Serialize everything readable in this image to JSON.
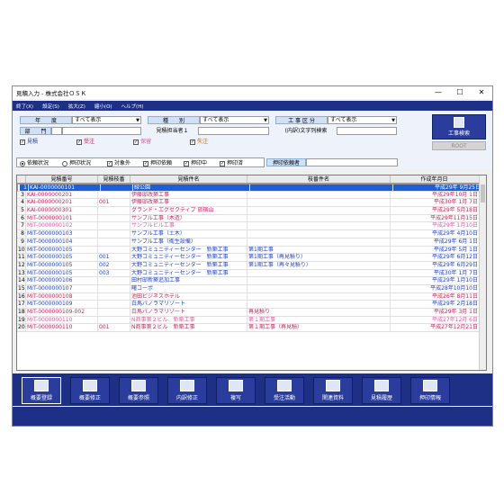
{
  "window": {
    "title": "見積入力 - 株式会社ＯＳＫ",
    "min": "—",
    "max": "☐",
    "close": "✕"
  },
  "menu": [
    "終了(X)",
    "設定(S)",
    "拡大(Z)",
    "縮小(O)",
    "ヘルプ(H)"
  ],
  "filters": {
    "year_label": "年　　度",
    "year_value": "すべて表示",
    "type_label": "種　　別",
    "type_value": "すべて表示",
    "section_label": "工 事 区 分",
    "section_value": "すべて表示",
    "dept_label": "部　　門",
    "dept_value": "",
    "estimator_label": "見積担当者１",
    "inner_label": "(内訳)文字列検索",
    "checks": [
      "見積",
      "受注",
      "保留",
      "失注"
    ],
    "radio1": "依頼状況",
    "radio2": "押印状況",
    "status_checks": [
      "対象外",
      "押印依頼",
      "押印中",
      "押印済"
    ],
    "requester_label": "押印依頼者",
    "search_button": "工事検索",
    "gray_button": "ROOT"
  },
  "grid": {
    "headers": [
      "見積番号",
      "見積枝番",
      "見積件名",
      "枝番件名",
      "作成年月日"
    ],
    "rows": [
      {
        "n": "1",
        "no": "KAI-0000000101",
        "br": "",
        "name": "緑公園",
        "bname": "",
        "date": "平成29年 9月25日",
        "color": "#1d3fc7"
      },
      {
        "n": "2",
        "no": "KAI-0000000101",
        "br": "001",
        "name": "緑公園",
        "bname": "",
        "date": "平成30年 1月 7日",
        "color": "#cc1f55"
      },
      {
        "n": "3",
        "no": "KAI-0000000201",
        "br": "",
        "name": "伊藤邸改築工事",
        "bname": "",
        "date": "平成29年10月 1日",
        "color": "#cc1f55"
      },
      {
        "n": "4",
        "no": "KAI-0000000201",
        "br": "001",
        "name": "伊藤邸改築工事",
        "bname": "",
        "date": "平成30年 1月 7日",
        "color": "#cc1f55"
      },
      {
        "n": "5",
        "no": "KAI-0000000301",
        "br": "",
        "name": "グランド・エグゼクティブ 旅宿山",
        "bname": "",
        "date": "平成29年 5月18日",
        "color": "#cc1f55"
      },
      {
        "n": "6",
        "no": "MIT-0000000101",
        "br": "",
        "name": "サンプル工事（木造）",
        "bname": "",
        "date": "平成29年11月15日",
        "color": "#cc1f55"
      },
      {
        "n": "7",
        "no": "MIT-0000000102",
        "br": "",
        "name": "サンプルビル工事",
        "bname": "",
        "date": "平成29年 1月10日",
        "color": "#e05aa0"
      },
      {
        "n": "8",
        "no": "MIT-0000000103",
        "br": "",
        "name": "サンプル工事（土木）",
        "bname": "",
        "date": "平成29年 4月10日",
        "color": "#1d3fc7"
      },
      {
        "n": "9",
        "no": "MIT-0000000104",
        "br": "",
        "name": "サンプル工事（衛生設備）",
        "bname": "",
        "date": "平成29年 6月 1日",
        "color": "#1d3fc7"
      },
      {
        "n": "10",
        "no": "MIT-0000000105",
        "br": "",
        "name": "大野コミュニティーセンター　新築工事",
        "bname": "第1期工事",
        "date": "平成29年 5月 1日",
        "color": "#1d3fc7"
      },
      {
        "n": "11",
        "no": "MIT-0000000105",
        "br": "001",
        "name": "大野コミュニティーセンター　新築工事",
        "bname": "第1期工事（再見積り）",
        "date": "平成29年 6月12日",
        "color": "#1d3fc7"
      },
      {
        "n": "12",
        "no": "MIT-0000000105",
        "br": "002",
        "name": "大野コミュニティーセンター　新築工事",
        "bname": "第1期工事（再々見積り）",
        "date": "平成29年 6月29日",
        "color": "#1d3fc7"
      },
      {
        "n": "13",
        "no": "MIT-0000000105",
        "br": "003",
        "name": "大野コミュニティーセンター　新築工事",
        "bname": "",
        "date": "平成30年 1月 7日",
        "color": "#1d3fc7"
      },
      {
        "n": "14",
        "no": "MIT-0000000106",
        "br": "",
        "name": "田村邸新築追加工事",
        "bname": "",
        "date": "平成29年 1月10日",
        "color": "#1d3fc7"
      },
      {
        "n": "15",
        "no": "MIT-0000000107",
        "br": "",
        "name": "曙コーポ",
        "bname": "",
        "date": "平成28年10月10日",
        "color": "#1d3fc7"
      },
      {
        "n": "16",
        "no": "MIT-0000000108",
        "br": "",
        "name": "池田ビジネスホテル",
        "bname": "",
        "date": "平成26年 8月11日",
        "color": "#cc1f55"
      },
      {
        "n": "17",
        "no": "MIT-0000000109",
        "br": "",
        "name": "白馬パノラマリゾート",
        "bname": "",
        "date": "平成29年 2月18日",
        "color": "#1d3fc7"
      },
      {
        "n": "18",
        "no": "MIT-0000000109-002",
        "br": "",
        "name": "白馬パノラマリゾート",
        "bname": "再見積り",
        "date": "平成29年 3月 1日",
        "color": "#cc1f55"
      },
      {
        "n": "19",
        "no": "MIT-0000000110",
        "br": "",
        "name": "N商事第２ビル　新築工事",
        "bname": "第１期工事",
        "date": "平成27年12月 6日",
        "color": "#e05aa0"
      },
      {
        "n": "20",
        "no": "MIT-0000000110",
        "br": "001",
        "name": "N商事第２ビル　新築工事",
        "bname": "第１期工事（再見積）",
        "date": "平成27年12月21日",
        "color": "#cc1f55"
      }
    ]
  },
  "toolbar": [
    "概要登録",
    "概要修正",
    "概要参照",
    "内訳修正",
    "複写",
    "受注活動",
    "関連資料",
    "見積履歴",
    "押印情報"
  ]
}
